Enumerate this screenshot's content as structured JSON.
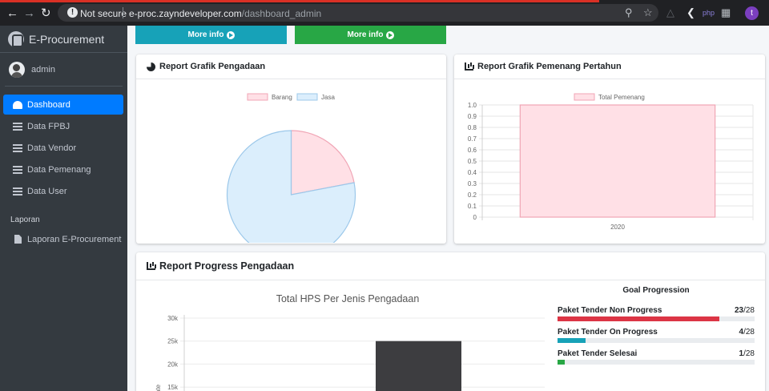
{
  "browser": {
    "security_label": "Not secure",
    "url_host": "e-proc.zayndeveloper.com",
    "url_path": "/dashboard_admin",
    "profile_initial": "t"
  },
  "sidebar": {
    "brand": "E-Procurement",
    "user": "admin",
    "items": [
      {
        "label": "Dashboard",
        "icon": "gauge-icon",
        "active": true
      },
      {
        "label": "Data FPBJ",
        "icon": "list-icon"
      },
      {
        "label": "Data Vendor",
        "icon": "list-icon"
      },
      {
        "label": "Data Pemenang",
        "icon": "list-icon"
      },
      {
        "label": "Data User",
        "icon": "list-icon"
      }
    ],
    "section_header": "Laporan",
    "report_item": {
      "label": "Laporan E-Procurement",
      "icon": "file-icon"
    }
  },
  "stat_buttons": [
    {
      "label": "More info",
      "color": "#17a2b8"
    },
    {
      "label": "More info",
      "color": "#28a745"
    }
  ],
  "cards": {
    "pie_title": "Report Grafik Pengadaan",
    "winner_title": "Report Grafik Pemenang Pertahun",
    "progress_title": "Report Progress Pengadaan"
  },
  "goal": {
    "title": "Goal Progression",
    "rows": [
      {
        "label": "Paket Tender Non Progress",
        "value": 23,
        "total": 28,
        "color": "#dc3545"
      },
      {
        "label": "Paket Tender On Progress",
        "value": 4,
        "total": 28,
        "color": "#17a2b8"
      },
      {
        "label": "Paket Tender Selesai",
        "value": 1,
        "total": 28,
        "color": "#28a745"
      }
    ]
  },
  "chart_data": [
    {
      "type": "pie",
      "categories": [
        "Barang",
        "Jasa"
      ],
      "values": [
        22,
        78
      ],
      "colors": [
        "#ffe0e6",
        "#dbeefc"
      ],
      "borders": [
        "#f0a5b5",
        "#9cc8ea"
      ],
      "legend": "top"
    },
    {
      "type": "bar",
      "categories": [
        "2020"
      ],
      "series": [
        {
          "name": "Total Pemenang",
          "values": [
            1
          ]
        }
      ],
      "ylim": [
        0,
        1
      ],
      "yticks": [
        "1.0",
        "0.9",
        "0.8",
        "0.7",
        "0.6",
        "0.5",
        "0.4",
        "0.3",
        "0.2",
        "0.1",
        "0"
      ],
      "grid": true,
      "legend": "top"
    },
    {
      "type": "bar",
      "title": "Total HPS Per Jenis Pengadaan",
      "yticks": [
        "30k",
        "25k",
        "20k",
        "15k"
      ],
      "ylim": [
        15000,
        30000
      ],
      "values": [
        25000
      ],
      "ylabel_fragment": "ate",
      "grid": true
    }
  ]
}
